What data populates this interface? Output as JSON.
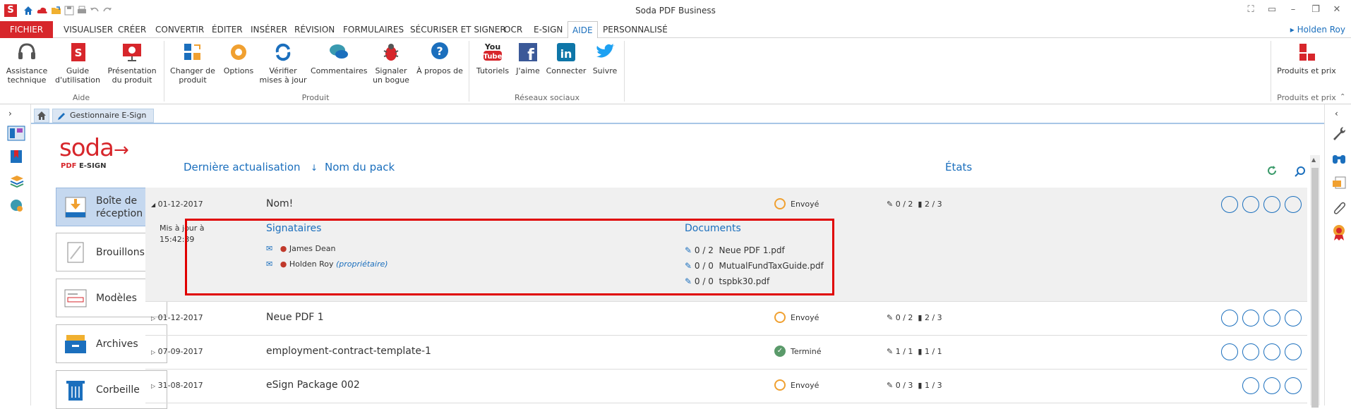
{
  "app": {
    "logo_letter": "S",
    "title": "Soda PDF Business",
    "user": "Holden Roy"
  },
  "menu": {
    "file": "FICHIER",
    "items": [
      "VISUALISER",
      "CRÉER",
      "CONVERTIR",
      "ÉDITER",
      "INSÉRER",
      "RÉVISION",
      "FORMULAIRES",
      "SÉCURISER ET SIGNER",
      "OCR",
      "E-SIGN",
      "AIDE",
      "PERSONNALISÉ"
    ],
    "active": "AIDE"
  },
  "ribbon": {
    "aide": {
      "group": "Aide",
      "b1": "Assistance\ntechnique",
      "b2": "Guide\nd'utilisation",
      "b3": "Présentation\ndu produit"
    },
    "produit": {
      "group": "Produit",
      "b1": "Changer de\nproduit",
      "b2": "Options",
      "b3": "Vérifier\nmises à jour",
      "b4": "Commentaires",
      "b5": "Signaler\nun bogue",
      "b6": "À propos de"
    },
    "social": {
      "group": "Réseaux sociaux",
      "b1": "Tutoriels",
      "b2": "J'aime",
      "b3": "Connecter",
      "b4": "Suivre",
      "youtube_logo_top": "You",
      "youtube_logo_bottom": "Tube"
    },
    "prix": {
      "group": "Produits et prix",
      "b1": "Produits et prix"
    }
  },
  "tab": {
    "label": "Gestionnaire E-Sign"
  },
  "logo": {
    "soda": "soda",
    "pdf": "PDF",
    "esign": "E-SIGN"
  },
  "nav": {
    "inbox": "Boîte de\nréception",
    "drafts": "Brouillons",
    "templates": "Modèles",
    "archives": "Archives",
    "trash": "Corbeille"
  },
  "table": {
    "col_date": "Dernière actualisation",
    "sort_arrow": "↓",
    "col_name": "Nom du pack",
    "col_status": "États",
    "rows": [
      {
        "date": "01-12-2017",
        "name": "Nom!",
        "status": "Envoyé",
        "sign": "0 / 2",
        "docs": "2 / 3"
      },
      {
        "date": "01-12-2017",
        "name": "Neue PDF 1",
        "status": "Envoyé",
        "sign": "0 / 2",
        "docs": "2 / 3"
      },
      {
        "date": "07-09-2017",
        "name": "employment-contract-template-1",
        "status": "Terminé",
        "sign": "1 / 1",
        "docs": "1 / 1"
      },
      {
        "date": "31-08-2017",
        "name": "eSign Package 002",
        "status": "Envoyé",
        "sign": "0 / 3",
        "docs": "1 / 3"
      }
    ]
  },
  "detail": {
    "updated_line1": "Mis à jour à",
    "updated_line2": "15:42:39",
    "signers_title": "Signataires",
    "signer1": "James Dean",
    "signer2": "Holden Roy",
    "owner": "(propriétaire)",
    "documents_title": "Documents",
    "docs": [
      {
        "count": "0  /  2",
        "name": "Neue PDF 1.pdf"
      },
      {
        "count": "0  /  0",
        "name": "MutualFundTaxGuide.pdf"
      },
      {
        "count": "0  /  0",
        "name": "tspbk30.pdf"
      }
    ]
  },
  "colors": {
    "accent": "#1b6fbd",
    "brand": "#d7262b",
    "sent": "#f0a030",
    "done": "#5a9a6a"
  }
}
